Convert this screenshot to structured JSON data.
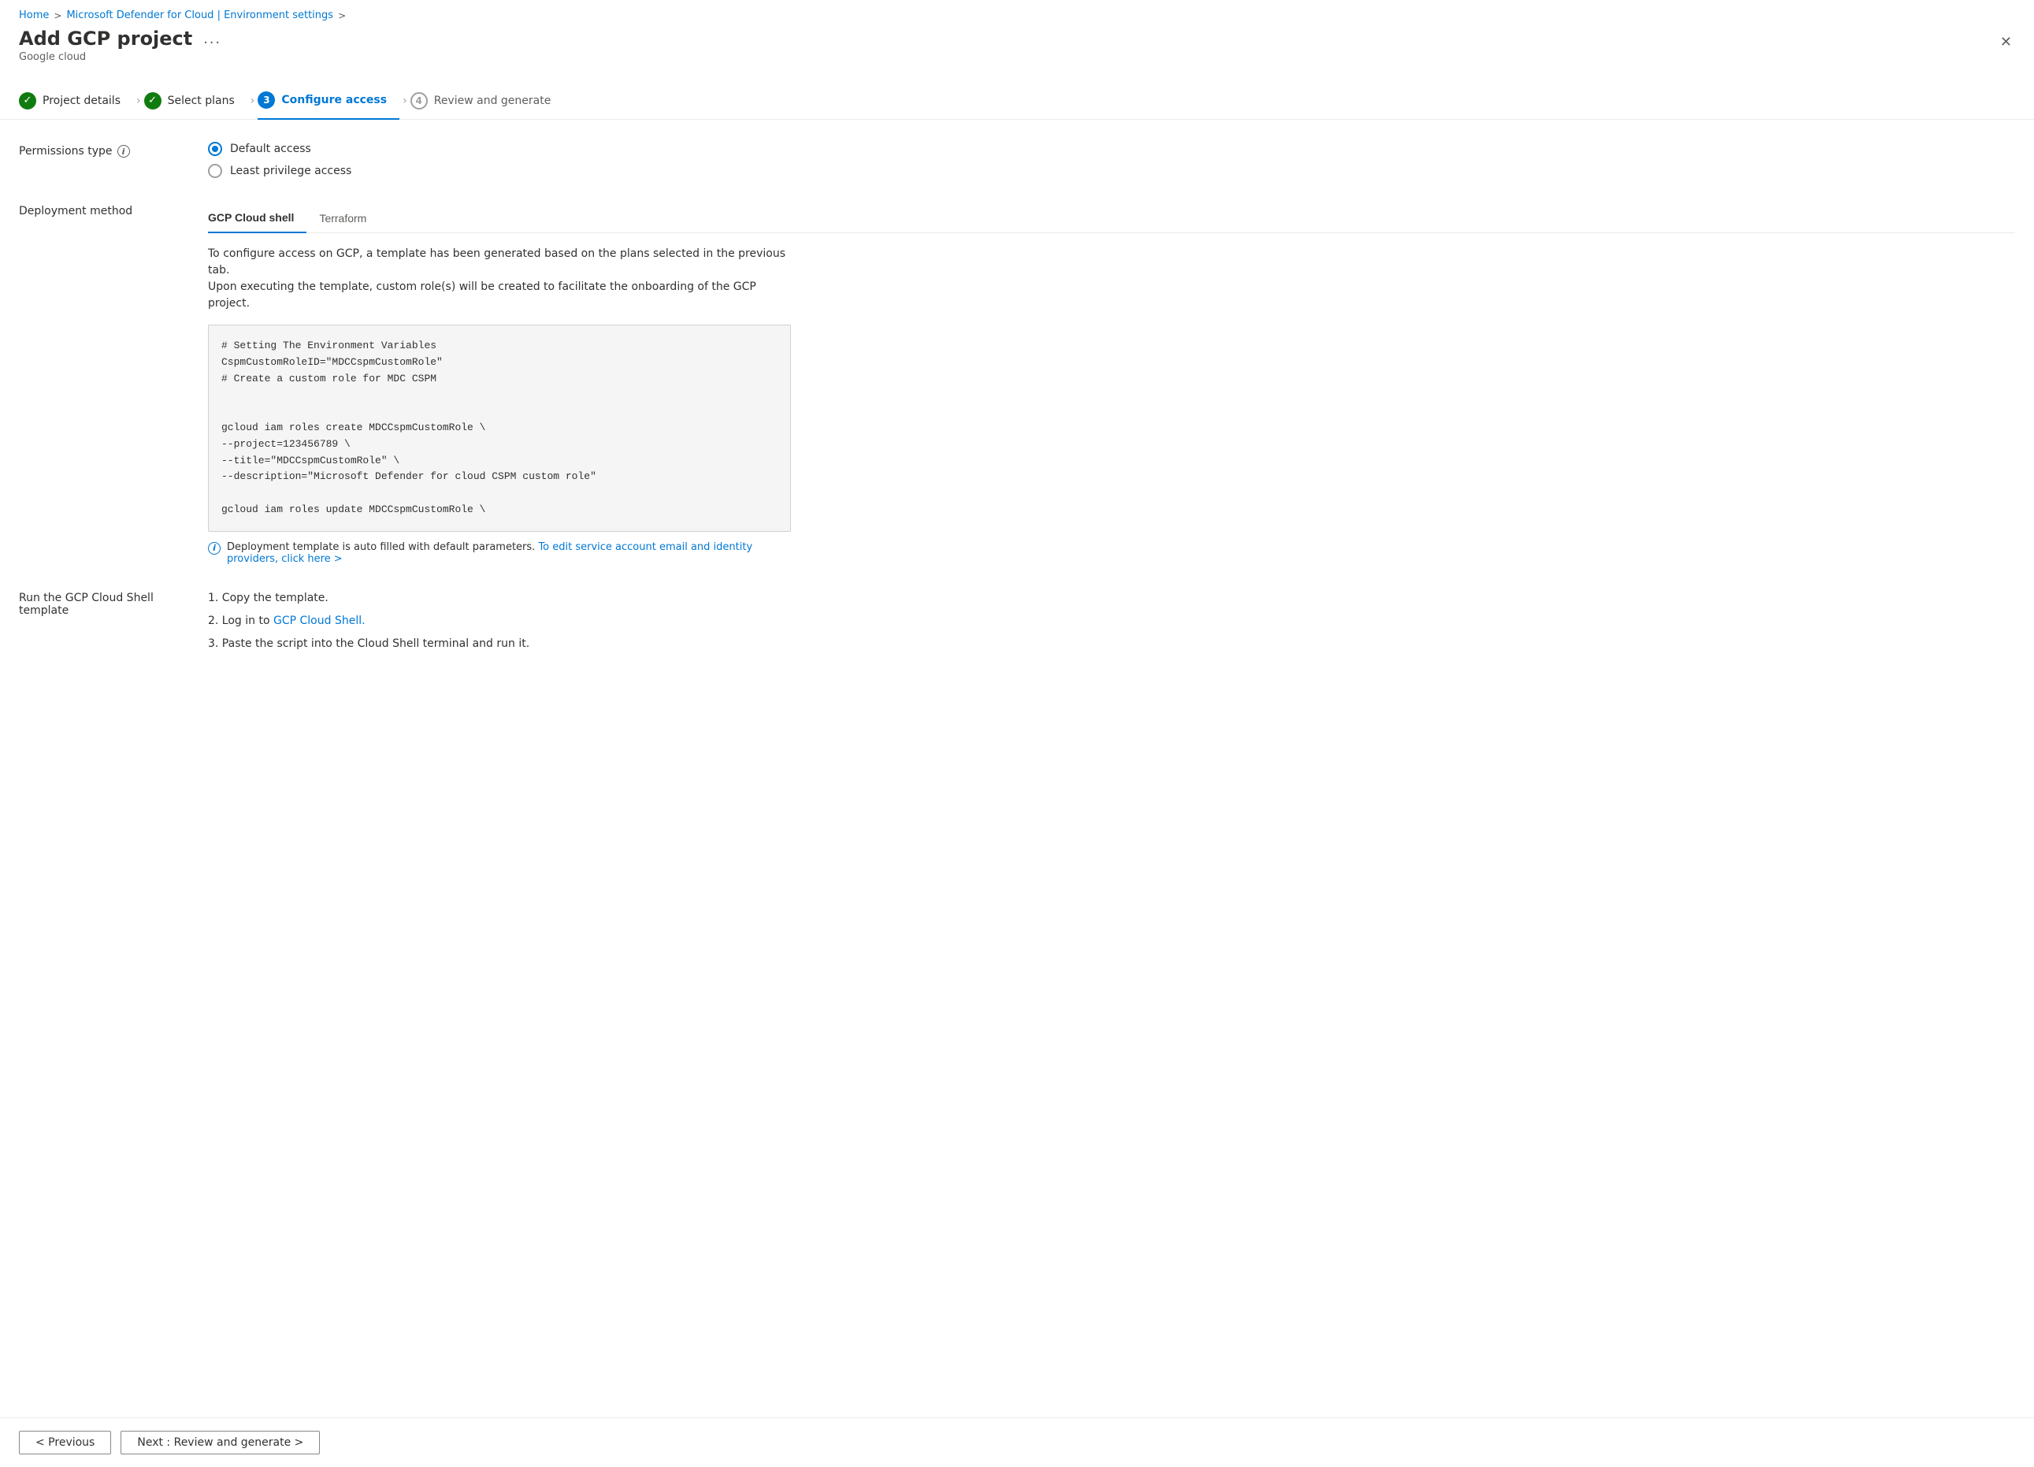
{
  "breadcrumb": {
    "home": "Home",
    "separator1": ">",
    "defender": "Microsoft Defender for Cloud | Environment settings",
    "separator2": ">"
  },
  "page": {
    "title": "Add GCP project",
    "ellipsis": "...",
    "subtitle": "Google cloud"
  },
  "steps": [
    {
      "id": 1,
      "label": "Project details",
      "state": "done",
      "symbol": "✓"
    },
    {
      "id": 2,
      "label": "Select plans",
      "state": "done",
      "symbol": "✓"
    },
    {
      "id": 3,
      "label": "Configure access",
      "state": "active",
      "symbol": "3"
    },
    {
      "id": 4,
      "label": "Review and generate",
      "state": "pending",
      "symbol": "4"
    }
  ],
  "permissions": {
    "label": "Permissions type",
    "options": [
      {
        "id": "default",
        "label": "Default access",
        "selected": true
      },
      {
        "id": "least",
        "label": "Least privilege access",
        "selected": false
      }
    ]
  },
  "deployment": {
    "label": "Deployment method",
    "tabs": [
      {
        "id": "gcp",
        "label": "GCP Cloud shell",
        "active": true
      },
      {
        "id": "terraform",
        "label": "Terraform",
        "active": false
      }
    ],
    "description": "To configure access on GCP, a template has been generated based on the plans selected in the previous tab.\nUpon executing the template, custom role(s) will be created to facilitate the onboarding of the GCP project.",
    "code": "# Setting The Environment Variables\nCspmCustomRoleID=\"MDCCspmCustomRole\"\n# Create a custom role for MDC CSPM\n\n\ngcloud iam roles create MDCCspmCustomRole \\\n--project=123456789 \\\n--title=\"MDCCspmCustomRole\" \\\n--description=\"Microsoft Defender for cloud CSPM custom role\"\n\ngcloud iam roles update MDCCspmCustomRole \\",
    "info_text": "Deployment template is auto filled with default parameters.",
    "info_link": "To edit service account email and identity providers, click here >"
  },
  "run_template": {
    "label": "Run the GCP Cloud Shell\ntemplate",
    "instructions": [
      {
        "num": "1.",
        "text": "Copy the template.",
        "link": null
      },
      {
        "num": "2.",
        "text": "Log in to ",
        "link_text": "GCP Cloud Shell.",
        "link_href": "#"
      },
      {
        "num": "3.",
        "text": "Paste the script into the Cloud Shell terminal and run it.",
        "link": null
      }
    ]
  },
  "footer": {
    "previous_label": "< Previous",
    "next_label": "Next : Review and generate >"
  }
}
